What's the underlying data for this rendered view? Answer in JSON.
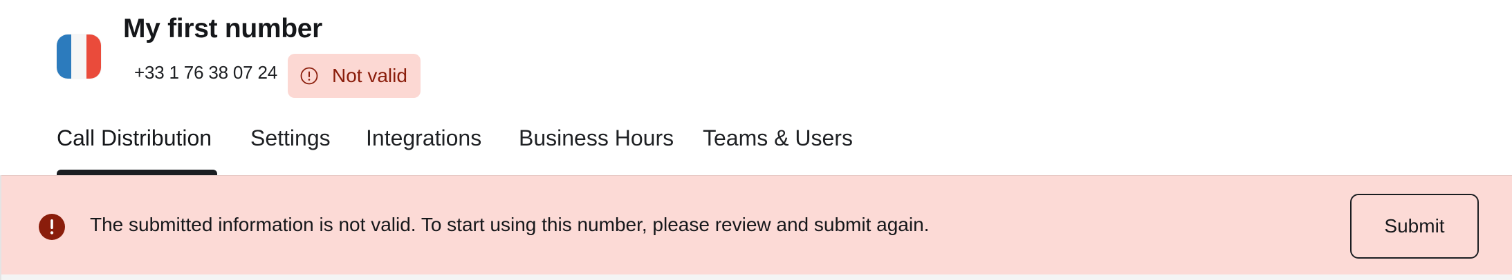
{
  "header": {
    "title": "My first number",
    "phone_number": "+33 1 76 38 07 24",
    "status_badge": {
      "label": "Not valid",
      "icon": "alert-circle-outline-icon",
      "background": "#fcd8d3",
      "text_color": "#8a1d0b"
    },
    "flag_icon": "france-flag-icon",
    "flag_colors": [
      "#2c7bbd",
      "#f6f6f6",
      "#ea4b3b"
    ]
  },
  "tabs": [
    {
      "label": "Call Distribution",
      "active": true
    },
    {
      "label": "Settings",
      "active": false
    },
    {
      "label": "Integrations",
      "active": false
    },
    {
      "label": "Business Hours",
      "active": false
    },
    {
      "label": "Teams & Users",
      "active": false
    }
  ],
  "banner": {
    "icon": "alert-circle-filled-icon",
    "message": "The submitted information is not valid. To start using this number, please review and submit again.",
    "submit_label": "Submit",
    "background": "#fcdad6",
    "icon_color": "#8a1d0b"
  }
}
